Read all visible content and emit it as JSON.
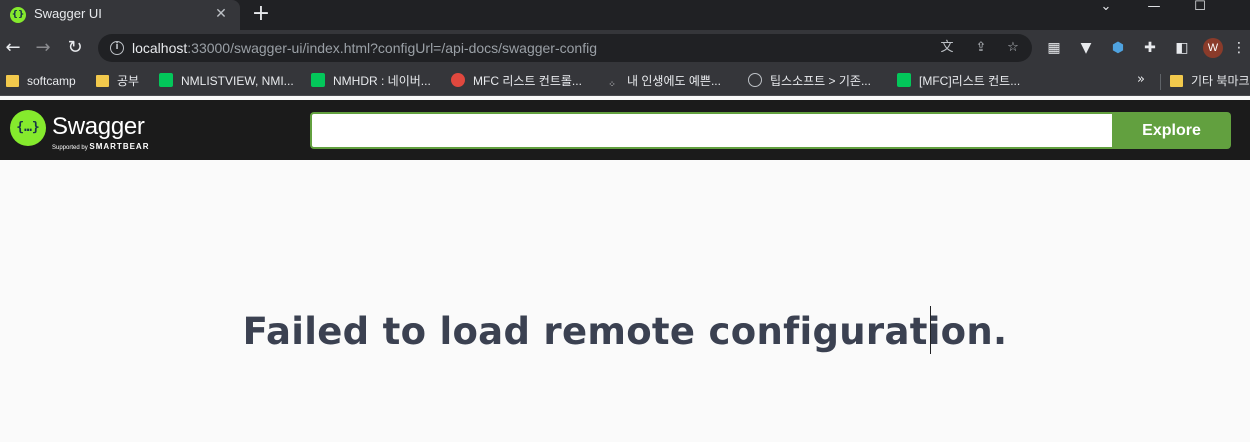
{
  "browser": {
    "tab": {
      "title": "Swagger UI",
      "close": "✕"
    },
    "new_tab": "+",
    "window_controls": {
      "menu": "⌄",
      "minimize": "—",
      "maximize": "☐"
    },
    "nav": {
      "back": "←",
      "forward": "→",
      "reload": "↻"
    },
    "address": {
      "host": "localhost",
      "rest": ":33000/swagger-ui/index.html?configUrl=/api-docs/swagger-config"
    },
    "omnibox_icons": [
      "translate-icon",
      "share-icon",
      "bookmark-star-icon"
    ],
    "extension_icons": [
      "qr-icon",
      "vue-devtools-icon",
      "extension-blue-icon",
      "puzzle-icon",
      "sidepanel-icon"
    ],
    "profile_initial": "W",
    "menu": "⋮"
  },
  "bookmarks": {
    "items": [
      {
        "label": "softcamp",
        "icon": "folder"
      },
      {
        "label": "공부",
        "icon": "folder"
      },
      {
        "label": "NMLISTVIEW, NMI...",
        "icon": "green"
      },
      {
        "label": "NMHDR : 네이버...",
        "icon": "green"
      },
      {
        "label": "MFC 리스트 컨트롤...",
        "icon": "red"
      },
      {
        "label": "내 인생에도 예쁜...",
        "icon": "dark"
      },
      {
        "label": "팁스소프트 > 기존...",
        "icon": "globe"
      },
      {
        "label": "[MFC]리스트 컨트...",
        "icon": "green"
      }
    ],
    "more": "»",
    "other": {
      "label": "기타 북마크",
      "icon": "folder"
    }
  },
  "swagger": {
    "logo_mark": "{…}",
    "logo_name": "Swagger",
    "logo_tag_prefix": "Supported by",
    "logo_tag_brand": "SMARTBEAR",
    "search_value": "",
    "explore_label": "Explore"
  },
  "content": {
    "error_message": "Failed to load remote configuration."
  }
}
